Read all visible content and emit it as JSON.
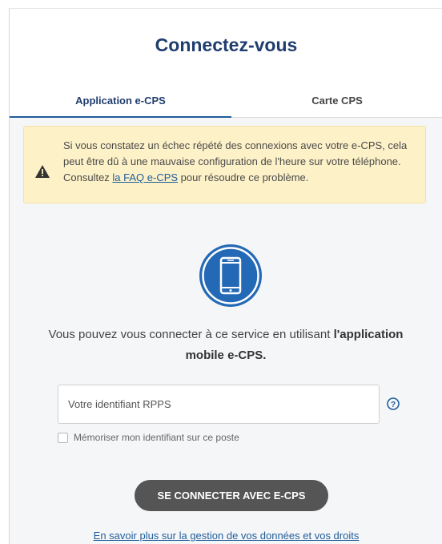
{
  "header": {
    "title": "Connectez-vous"
  },
  "tabs": [
    {
      "label": "Application e-CPS",
      "active": true
    },
    {
      "label": "Carte CPS",
      "active": false
    }
  ],
  "alert": {
    "text_before": "Si vous constatez un échec répété des connexions avec votre e-CPS, cela peut être dû à une mauvaise configuration de l'heure sur votre téléphone. Consultez ",
    "link_text": "la FAQ e-CPS",
    "text_after": " pour résoudre ce problème.",
    "icon": "warning-icon"
  },
  "main": {
    "icon": "smartphone-icon",
    "intro_text": "Vous pouvez vous connecter à ce service en utilisant ",
    "intro_bold": "l'application mobile e-CPS.",
    "rpps_placeholder": "Votre identifiant RPPS",
    "help_icon": "question-icon",
    "remember_label": "Mémoriser mon identifiant sur ce poste",
    "connect_button": "SE CONNECTER AVEC E-CPS",
    "rights_link": "En savoir plus sur la gestion de vos données et vos droits"
  },
  "colors": {
    "title": "#1f3d6e",
    "accent": "#1f5d9a",
    "alert_bg": "#fdf1c8",
    "button_bg": "#555555"
  }
}
